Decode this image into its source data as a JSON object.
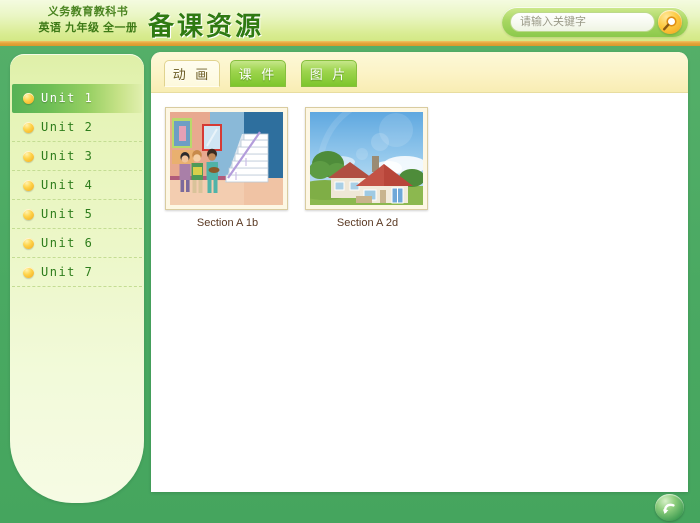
{
  "header": {
    "book_meta_line1": "义务教育教科书",
    "book_meta_line2": "英语  九年级  全一册",
    "app_title": "备课资源"
  },
  "search": {
    "placeholder": "请输入关键字",
    "value": "",
    "icon": "search-icon"
  },
  "sidebar": {
    "items": [
      {
        "label": "Unit 1",
        "active": true
      },
      {
        "label": "Unit 2",
        "active": false
      },
      {
        "label": "Unit 3",
        "active": false
      },
      {
        "label": "Unit 4",
        "active": false
      },
      {
        "label": "Unit 5",
        "active": false
      },
      {
        "label": "Unit 6",
        "active": false
      },
      {
        "label": "Unit 7",
        "active": false
      }
    ]
  },
  "content": {
    "tabs": [
      {
        "label": "动 画",
        "active": true
      },
      {
        "label": "课 件",
        "active": false
      },
      {
        "label": "图 片",
        "active": false
      }
    ],
    "items": [
      {
        "caption": "Section A 1b",
        "thumb": "classroom-hallway-students"
      },
      {
        "caption": "Section A 2d",
        "thumb": "houses-landscape"
      }
    ]
  },
  "footer": {
    "back_button_icon": "back-arrow-icon"
  },
  "colors": {
    "page_background": "#4aa962",
    "header_top": "#f4fbe0",
    "header_bottom": "#cfe77e",
    "header_rule": "#e3a53a",
    "title_green": "#2f7a12",
    "tab_active_cream": "#fffdf0",
    "tab_green": "#9ed54e",
    "sidebar_cream": "#ecf7c8",
    "unit_text_green": "#2e7d1c",
    "caption_brown": "#5b3a24"
  }
}
